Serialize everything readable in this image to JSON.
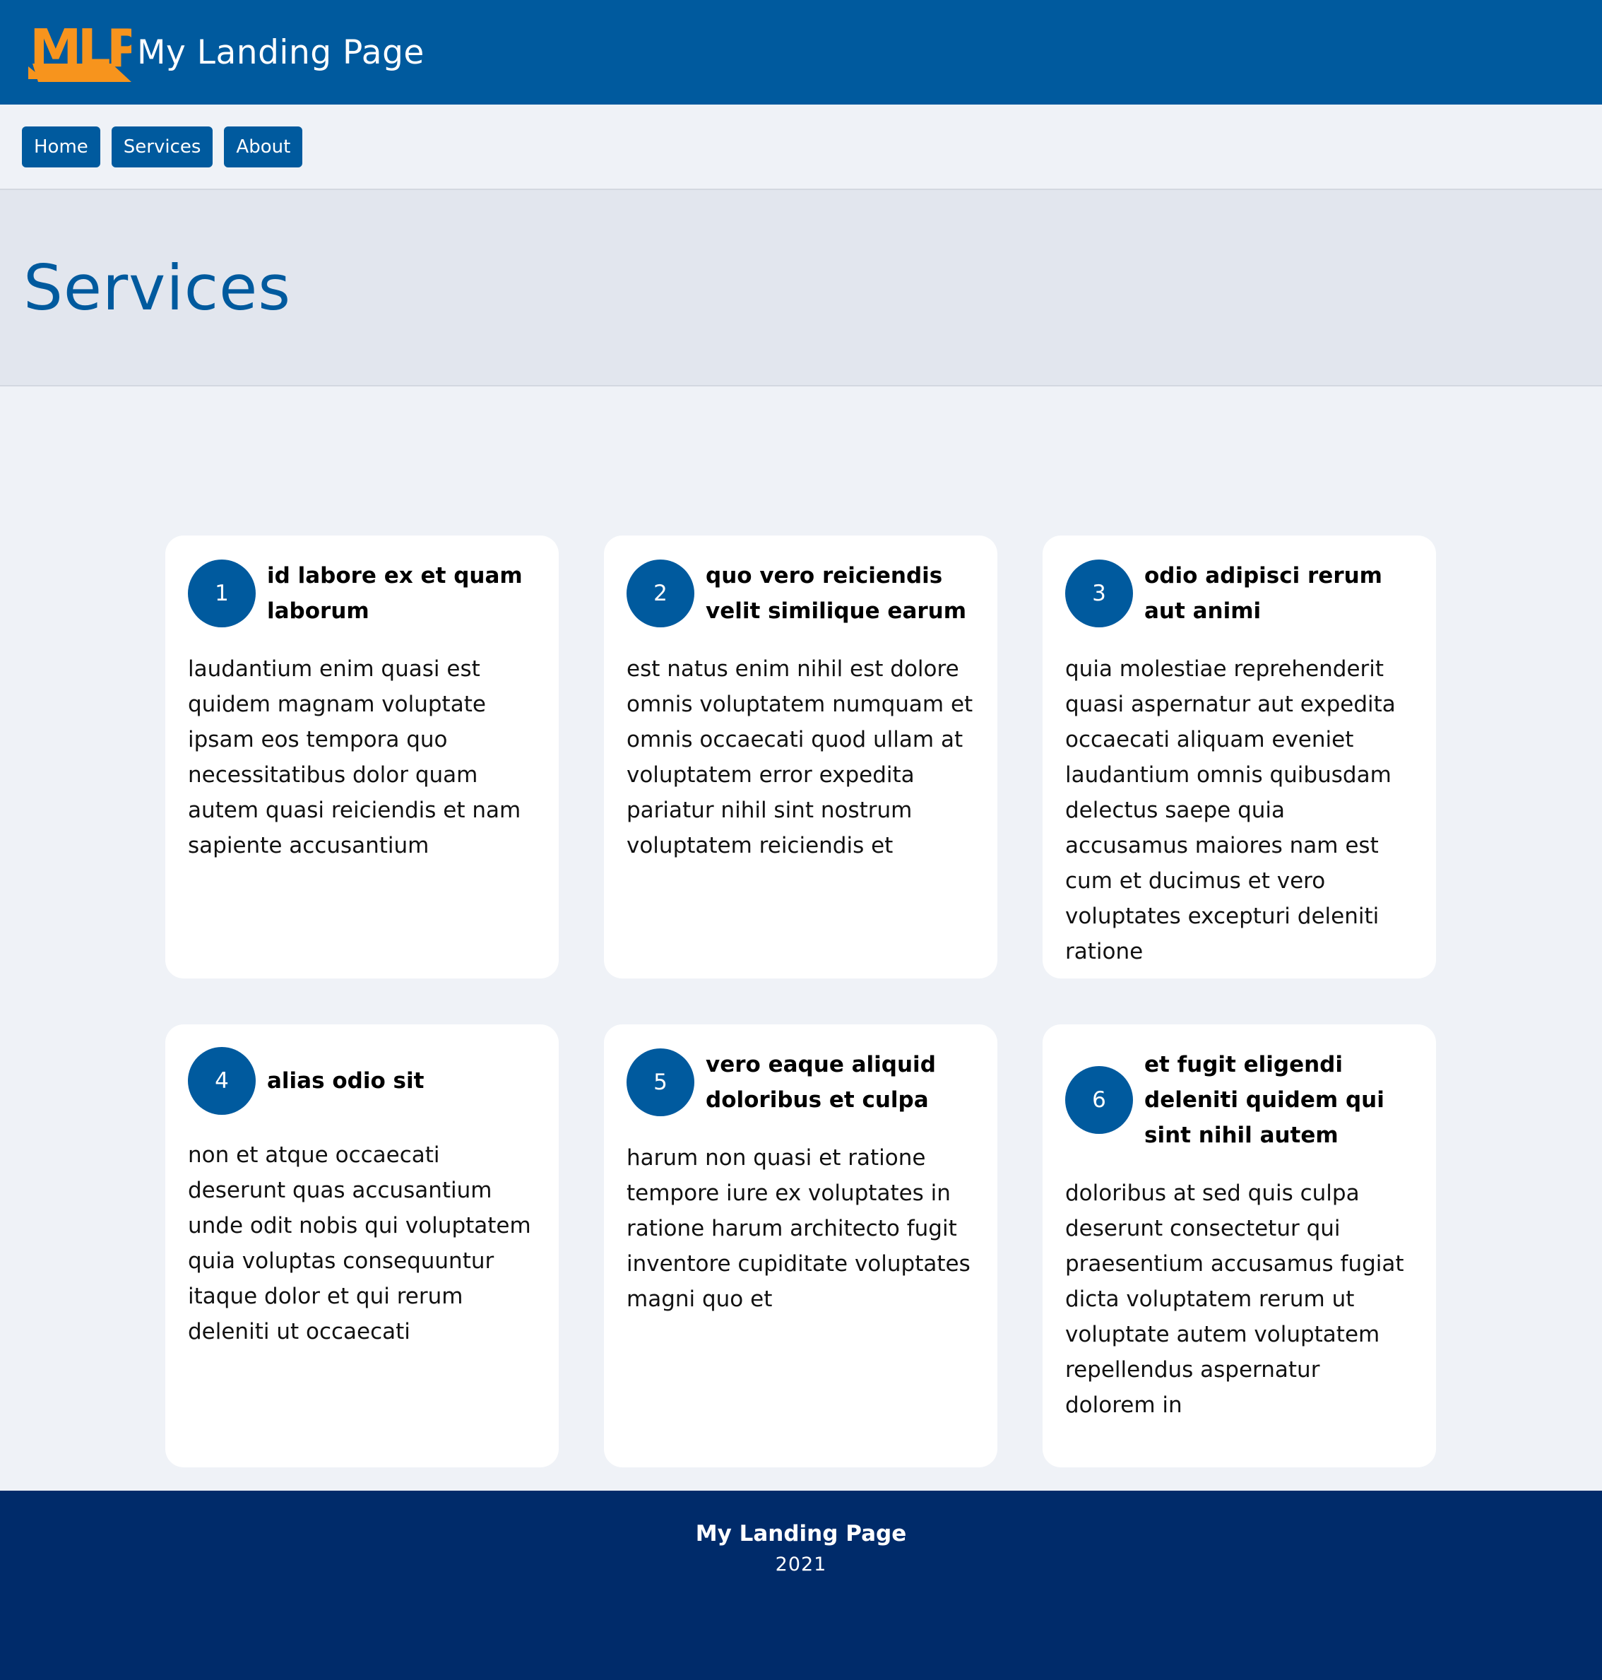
{
  "header": {
    "logo_text": "MLP",
    "site_title": "My Landing Page"
  },
  "nav": {
    "items": [
      {
        "label": "Home"
      },
      {
        "label": "Services"
      },
      {
        "label": "About"
      }
    ]
  },
  "hero": {
    "title": "Services"
  },
  "cards": [
    {
      "number": "1",
      "title": "id labore ex et quam laborum",
      "body": "laudantium enim quasi est quidem magnam voluptate ipsam eos tempora quo necessitatibus dolor quam autem quasi reiciendis et nam sapiente accusantium"
    },
    {
      "number": "2",
      "title": "quo vero reiciendis velit similique earum",
      "body": "est natus enim nihil est dolore omnis voluptatem numquam et omnis occaecati quod ullam at voluptatem error expedita pariatur nihil sint nostrum voluptatem reiciendis et"
    },
    {
      "number": "3",
      "title": "odio adipisci rerum aut animi",
      "body": "quia molestiae reprehenderit quasi aspernatur aut expedita occaecati aliquam eveniet laudantium omnis quibusdam delectus saepe quia accusamus maiores nam est cum et ducimus et vero voluptates excepturi deleniti ratione"
    },
    {
      "number": "4",
      "title": "alias odio sit",
      "body": "non et atque occaecati deserunt quas accusantium unde odit nobis qui voluptatem quia voluptas consequuntur itaque dolor et qui rerum deleniti ut occaecati"
    },
    {
      "number": "5",
      "title": "vero eaque aliquid doloribus et culpa",
      "body": "harum non quasi et ratione tempore iure ex voluptates in ratione harum architecto fugit inventore cupiditate voluptates magni quo et"
    },
    {
      "number": "6",
      "title": "et fugit eligendi deleniti quidem qui sint nihil autem",
      "body": "doloribus at sed quis culpa deserunt consectetur qui praesentium accusamus fugiat dicta voluptatem rerum ut voluptate autem voluptatem repellendus aspernatur dolorem in"
    }
  ],
  "footer": {
    "title": "My Landing Page",
    "year": "2021"
  },
  "colors": {
    "primary": "#005a9e",
    "logo_accent": "#f7941d",
    "footer_bg": "#002b6a",
    "page_bg": "#eff2f7",
    "hero_bg": "#e2e6ee"
  }
}
